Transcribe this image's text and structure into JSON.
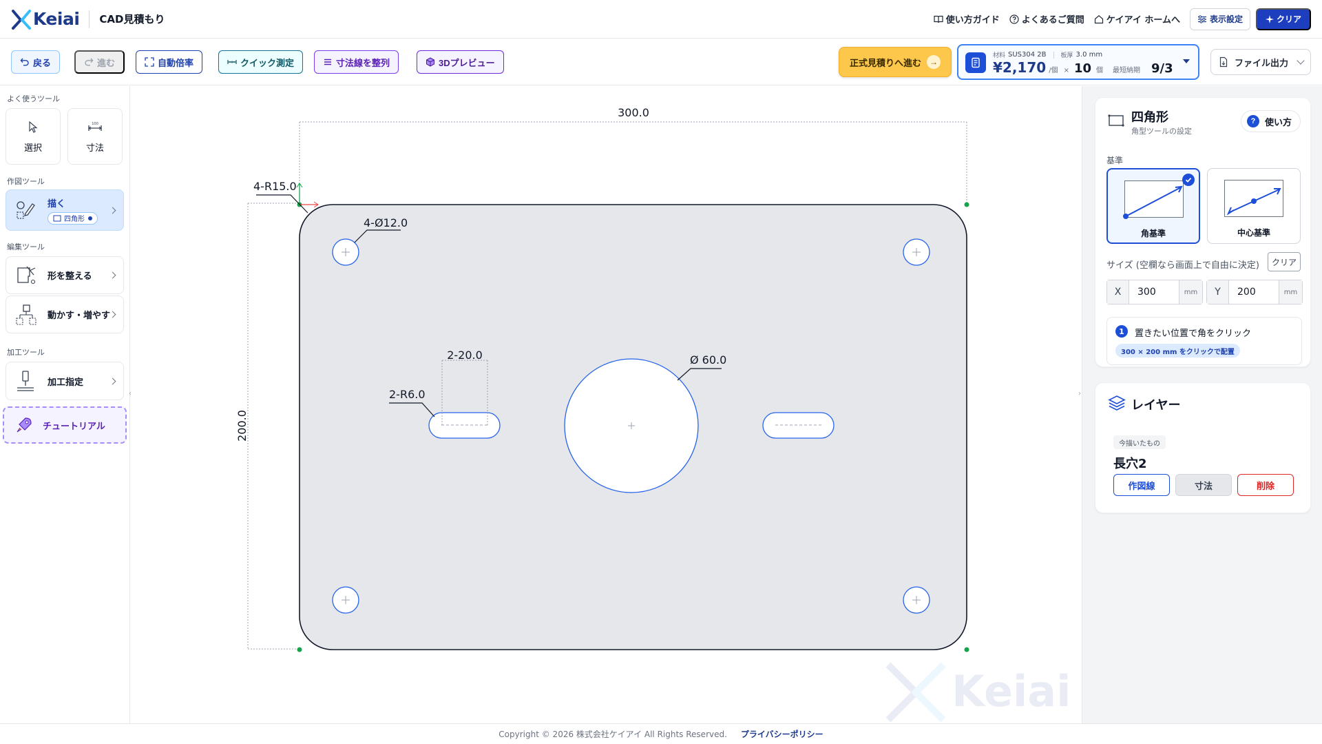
{
  "header": {
    "logo_text": "Keiai",
    "app_title": "CAD見積もり",
    "links": [
      "使い方ガイド",
      "よくあるご質問",
      "ケイアイ ホームへ"
    ],
    "display_settings": "表示設定",
    "clear": "クリア"
  },
  "toolbar": {
    "back": "戻る",
    "forward": "進む",
    "auto_scale": "自動倍率",
    "quick_measure": "クイック測定",
    "align_dims": "寸法線を整列",
    "preview_3d": "3Dプレビュー",
    "formal_quote": "正式見積りへ進む",
    "price": {
      "material_label": "材料",
      "material": "SUS304 2B",
      "thickness_label": "板厚",
      "thickness": "3.0 mm",
      "amount": "¥2,170",
      "per_unit": "/個",
      "times": "×",
      "quantity": "10",
      "qty_unit": "個",
      "delivery_label": "最短納期",
      "delivery": "9/3"
    },
    "file_export": "ファイル出力"
  },
  "sidebar": {
    "favorites_label": "よく使うツール",
    "select": "選択",
    "dimension": "寸法",
    "draw_tools_label": "作図ツール",
    "draw": "描く",
    "draw_mode": "四角形",
    "edit_tools_label": "編集ツール",
    "shape": "形を整える",
    "move": "動かす・増やす",
    "process_tools_label": "加工ツール",
    "process": "加工指定",
    "tutorial": "チュートリアル"
  },
  "canvas": {
    "dim_width": "300.0",
    "dim_height": "200.0",
    "corner_radius": "4-R15.0",
    "hole_dia": "4-Ø12.0",
    "slot_length": "2-20.0",
    "slot_radius": "2-R6.0",
    "center_dia": "Ø 60.0",
    "watermark": "Keiai"
  },
  "panel": {
    "shape_title": "四角形",
    "shape_sub": "角型ツールの設定",
    "howto": "使い方",
    "base_label": "基準",
    "corner_base": "角基準",
    "center_base": "中心基準",
    "size_label": "サイズ (空欄なら画面上で自由に決定)",
    "size_clear": "クリア",
    "x_label": "X",
    "x_value": "300",
    "y_label": "Y",
    "y_value": "200",
    "unit": "mm",
    "hint_step": "1",
    "hint_text": "置きたい位置で角をクリック",
    "hint_chip": "300 × 200 mm をクリックで配置",
    "layer_title": "レイヤー",
    "recent_label": "今描いたもの",
    "layer_name": "長穴2",
    "btn_aux": "作図線",
    "btn_dim": "寸法",
    "btn_delete": "削除"
  },
  "footer": {
    "copyright": "Copyright © 2026 株式会社ケイアイ All Rights Reserved.",
    "privacy": "プライバシーポリシー"
  },
  "colors": {
    "brand": "#1e3a8a",
    "accent": "#1d4ed8",
    "quote_button": "#fcc74a",
    "plate_fill": "#e5e7eb",
    "feature_stroke": "#2563eb",
    "delete": "#dc2626"
  }
}
